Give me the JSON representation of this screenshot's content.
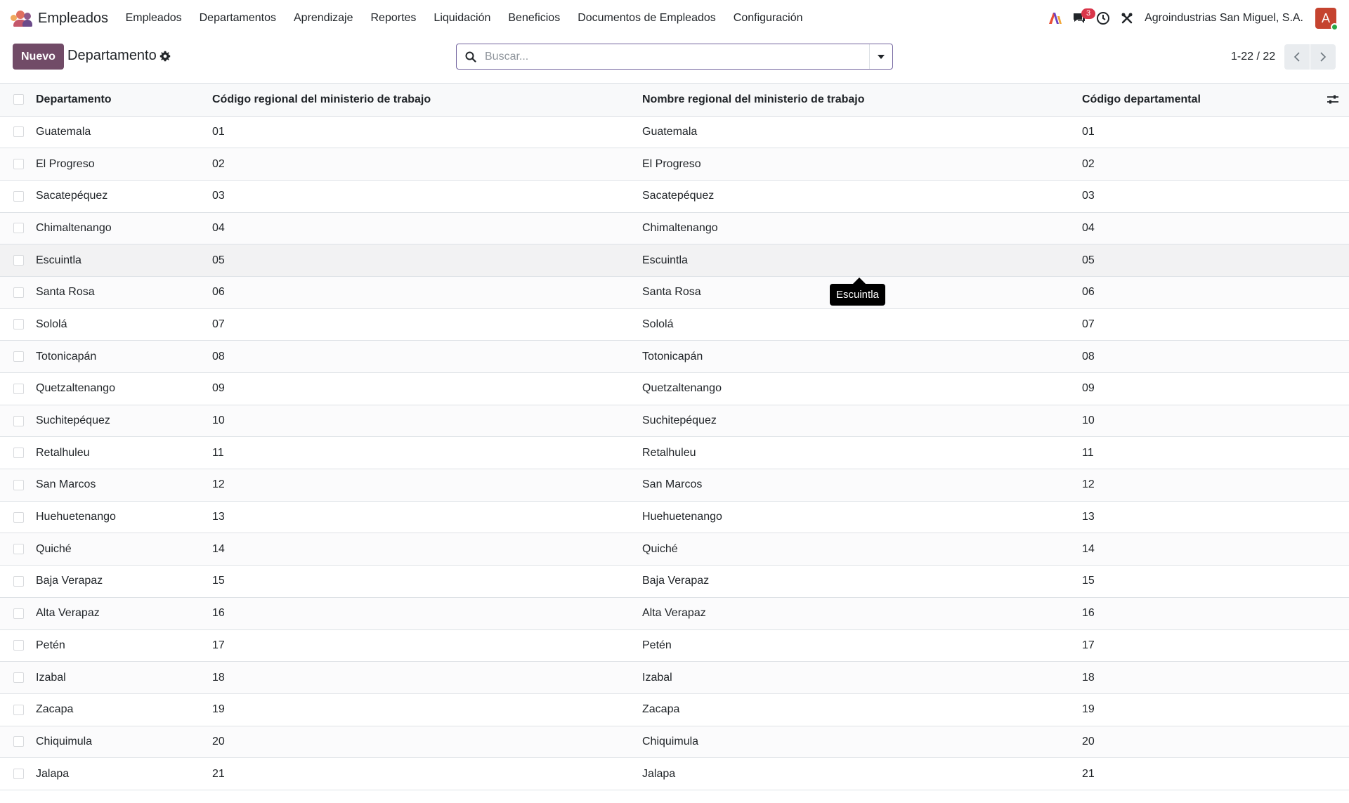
{
  "app": {
    "name": "Empleados",
    "menu": [
      "Empleados",
      "Departamentos",
      "Aprendizaje",
      "Reportes",
      "Liquidación",
      "Beneficios",
      "Documentos de Empleados",
      "Configuración"
    ],
    "message_count": "3",
    "company": "Agroindustrias San Miguel, S.A.",
    "avatar_letter": "A",
    "accent_color": "#714b67"
  },
  "control": {
    "new_label": "Nuevo",
    "title": "Departamento",
    "search_placeholder": "Buscar...",
    "pager": "1-22 / 22"
  },
  "table": {
    "headers": [
      "Departamento",
      "Código regional del ministerio de trabajo",
      "Nombre regional del ministerio de trabajo",
      "Código departamental"
    ],
    "rows": [
      [
        "Guatemala",
        "01",
        "Guatemala",
        "01"
      ],
      [
        "El Progreso",
        "02",
        "El Progreso",
        "02"
      ],
      [
        "Sacatepéquez",
        "03",
        "Sacatepéquez",
        "03"
      ],
      [
        "Chimaltenango",
        "04",
        "Chimaltenango",
        "04"
      ],
      [
        "Escuintla",
        "05",
        "Escuintla",
        "05"
      ],
      [
        "Santa Rosa",
        "06",
        "Santa Rosa",
        "06"
      ],
      [
        "Sololá",
        "07",
        "Sololá",
        "07"
      ],
      [
        "Totonicapán",
        "08",
        "Totonicapán",
        "08"
      ],
      [
        "Quetzaltenango",
        "09",
        "Quetzaltenango",
        "09"
      ],
      [
        "Suchitepéquez",
        "10",
        "Suchitepéquez",
        "10"
      ],
      [
        "Retalhuleu",
        "11",
        "Retalhuleu",
        "11"
      ],
      [
        "San Marcos",
        "12",
        "San Marcos",
        "12"
      ],
      [
        "Huehuetenango",
        "13",
        "Huehuetenango",
        "13"
      ],
      [
        "Quiché",
        "14",
        "Quiché",
        "14"
      ],
      [
        "Baja Verapaz",
        "15",
        "Baja Verapaz",
        "15"
      ],
      [
        "Alta Verapaz",
        "16",
        "Alta Verapaz",
        "16"
      ],
      [
        "Petén",
        "17",
        "Petén",
        "17"
      ],
      [
        "Izabal",
        "18",
        "Izabal",
        "18"
      ],
      [
        "Zacapa",
        "19",
        "Zacapa",
        "19"
      ],
      [
        "Chiquimula",
        "20",
        "Chiquimula",
        "20"
      ],
      [
        "Jalapa",
        "21",
        "Jalapa",
        "21"
      ]
    ]
  },
  "tooltip": {
    "text": "Escuintla"
  }
}
